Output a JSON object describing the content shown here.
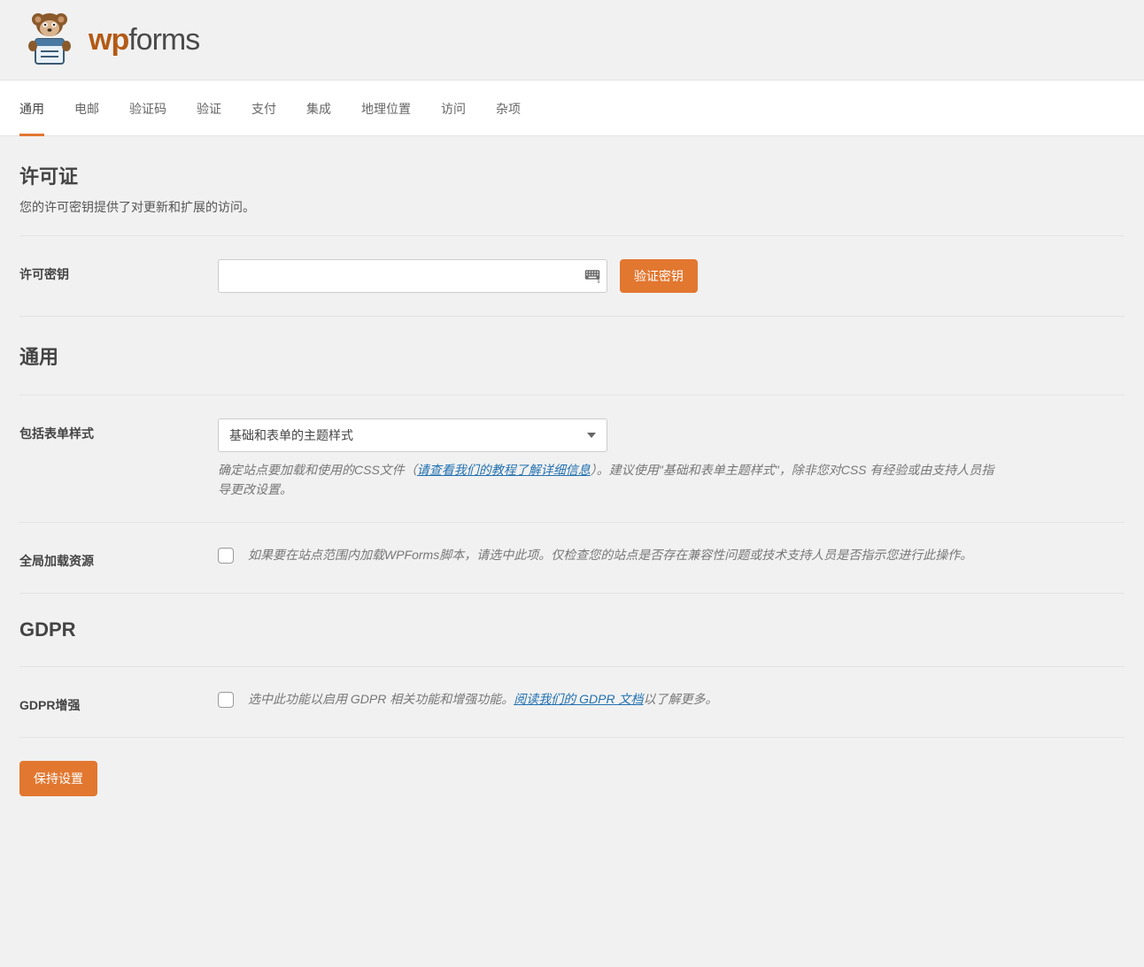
{
  "logo": {
    "brand_wp": "wp",
    "brand_forms": "forms"
  },
  "tabs": [
    {
      "label": "通用",
      "active": true
    },
    {
      "label": "电邮",
      "active": false
    },
    {
      "label": "验证码",
      "active": false
    },
    {
      "label": "验证",
      "active": false
    },
    {
      "label": "支付",
      "active": false
    },
    {
      "label": "集成",
      "active": false
    },
    {
      "label": "地理位置",
      "active": false
    },
    {
      "label": "访问",
      "active": false
    },
    {
      "label": "杂项",
      "active": false
    }
  ],
  "license": {
    "heading": "许可证",
    "desc": "您的许可密钥提供了对更新和扩展的访问。",
    "key_label": "许可密钥",
    "key_value": "",
    "verify_button": "验证密钥"
  },
  "general": {
    "heading": "通用",
    "form_styling": {
      "label": "包括表单样式",
      "selected": "基础和表单的主题样式",
      "help_before": "确定站点要加载和使用的CSS文件（",
      "help_link": "请查看我们的教程了解详细信息",
      "help_after": "）。建议使用\"基础和表单主题样式\"，除非您对CSS 有经验或由支持人员指导更改设置。"
    },
    "global_assets": {
      "label": "全局加载资源",
      "checked": false,
      "desc": "如果要在站点范围内加载WPForms脚本，请选中此项。仅检查您的站点是否存在兼容性问题或技术支持人员是否指示您进行此操作。"
    }
  },
  "gdpr": {
    "heading": "GDPR",
    "enhance": {
      "label": "GDPR增强",
      "checked": false,
      "desc_before": "选中此功能以启用 GDPR 相关功能和增强功能。",
      "desc_link": "阅读我们的 GDPR 文档",
      "desc_after": "以了解更多。"
    }
  },
  "save_button": "保持设置"
}
